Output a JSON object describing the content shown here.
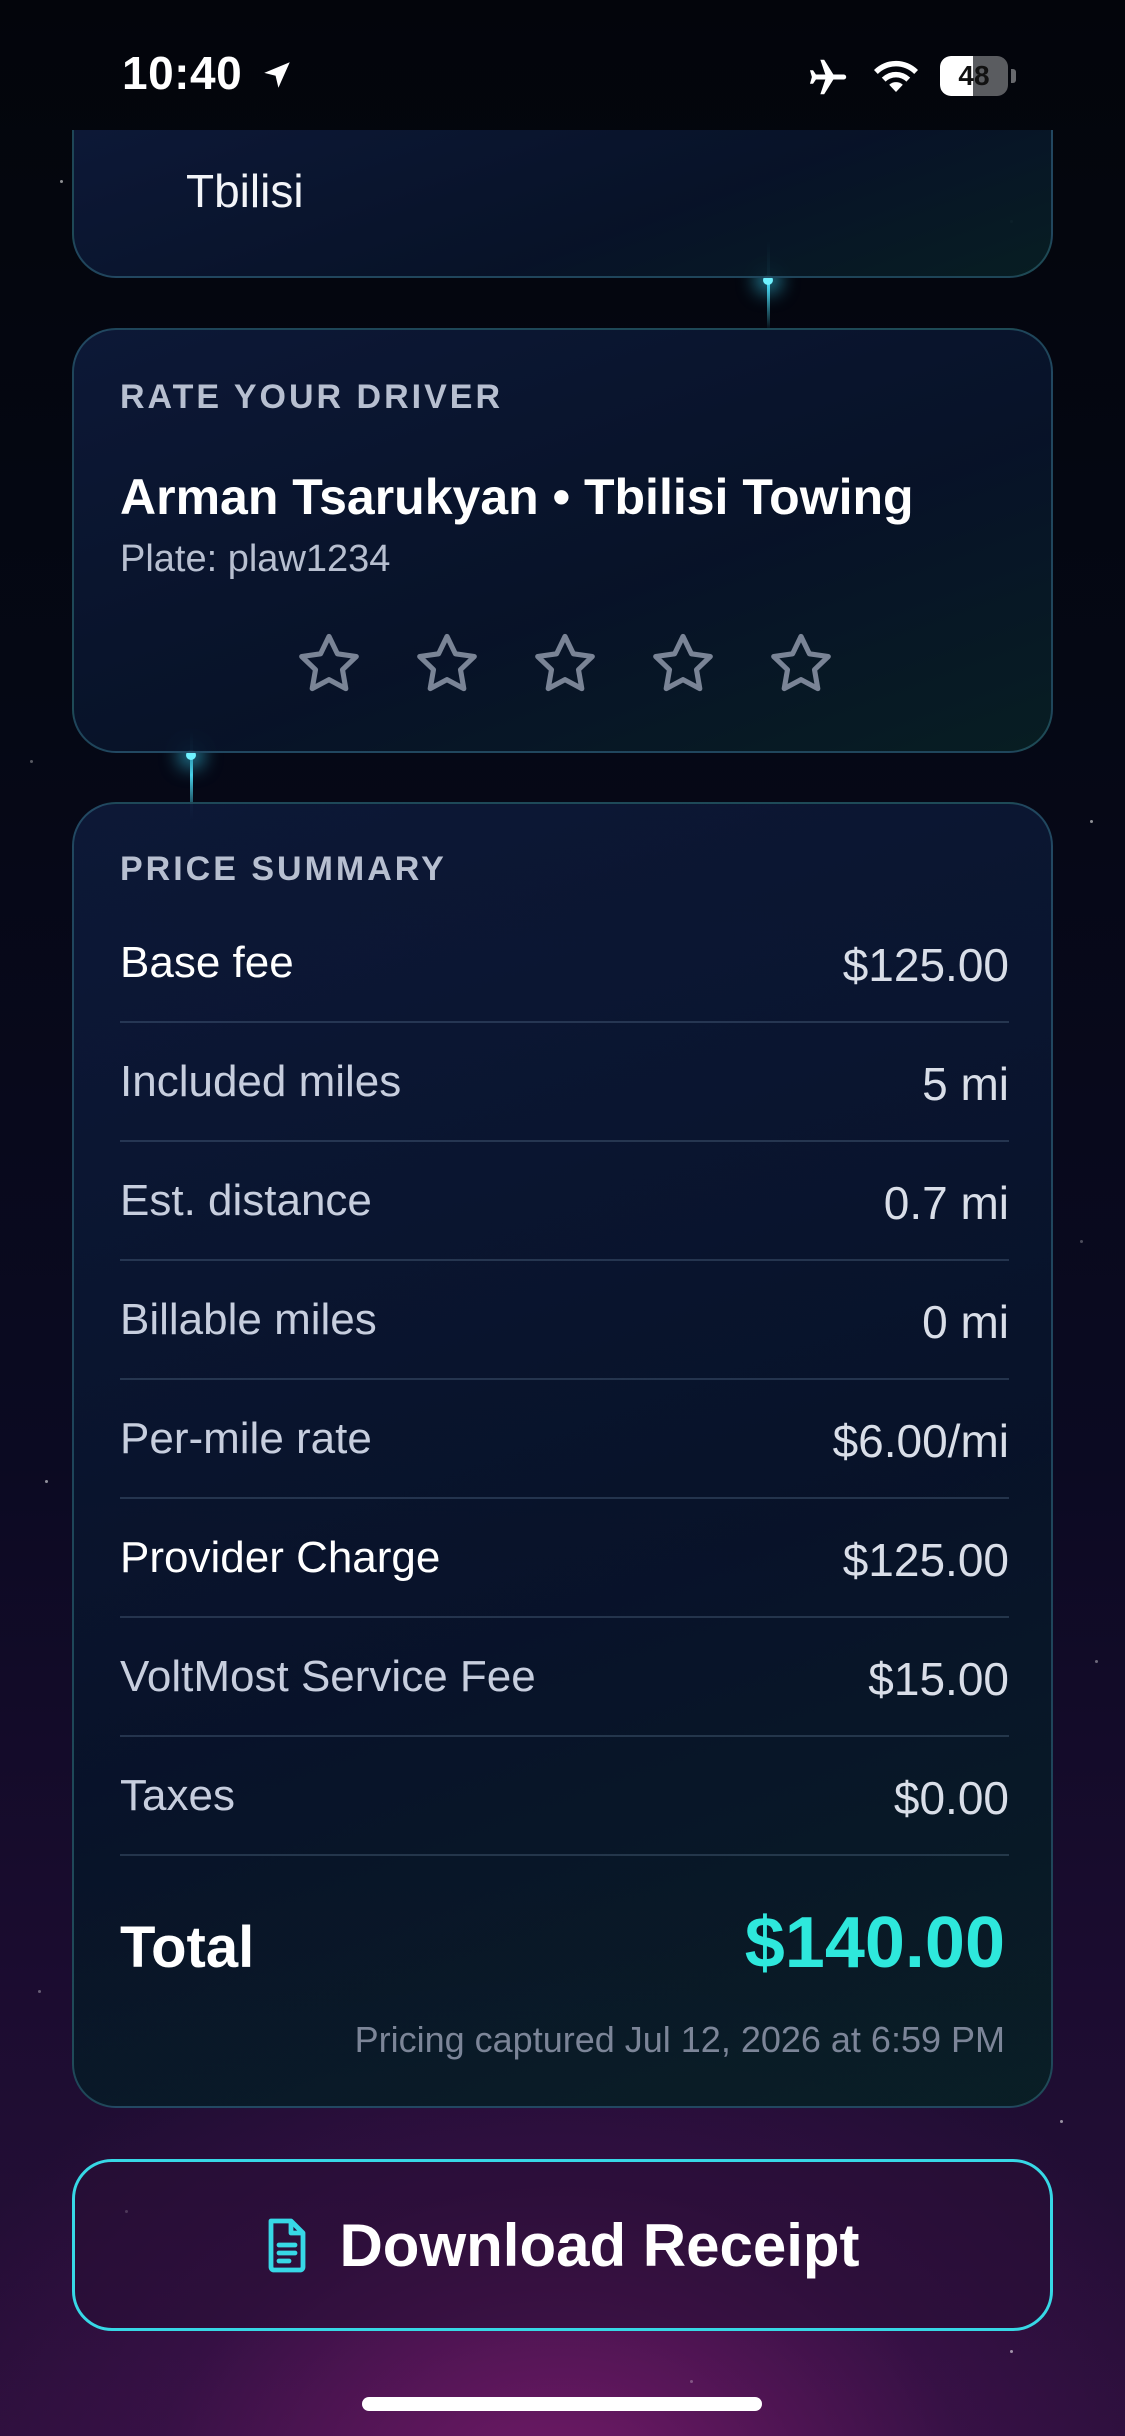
{
  "status_bar": {
    "time": "10:40",
    "battery": "48",
    "battery_level": 0.48,
    "icons": [
      "location-arrow-icon",
      "airplane-icon",
      "wifi-icon",
      "battery-icon"
    ]
  },
  "location_card": {
    "city": "Tbilisi"
  },
  "rate_driver": {
    "section_title": "RATE YOUR DRIVER",
    "driver_line": "Arman Tsarukyan • Tbilisi Towing",
    "plate": "Plate: plaw1234",
    "star_count": 5,
    "rating": 0
  },
  "price_summary": {
    "section_title": "PRICE SUMMARY",
    "rows": [
      {
        "label": "Base fee",
        "value": "$125.00"
      },
      {
        "label": "Included miles",
        "value": "5 mi"
      },
      {
        "label": "Est. distance",
        "value": "0.7 mi"
      },
      {
        "label": "Billable miles",
        "value": "0 mi"
      },
      {
        "label": "Per-mile rate",
        "value": "$6.00/mi"
      },
      {
        "label": "Provider Charge",
        "value": "$125.00"
      },
      {
        "label": "VoltMost Service Fee",
        "value": "$15.00"
      },
      {
        "label": "Taxes",
        "value": "$0.00"
      }
    ],
    "total_label": "Total",
    "total_value": "$140.00",
    "captured_note": "Pricing captured Jul 12, 2026 at 6:59 PM"
  },
  "actions": {
    "download_label": "Download Receipt"
  },
  "colors": {
    "accent": "#2ee8dc",
    "button_border": "#37d8e6",
    "card_border": "#3c8296"
  }
}
